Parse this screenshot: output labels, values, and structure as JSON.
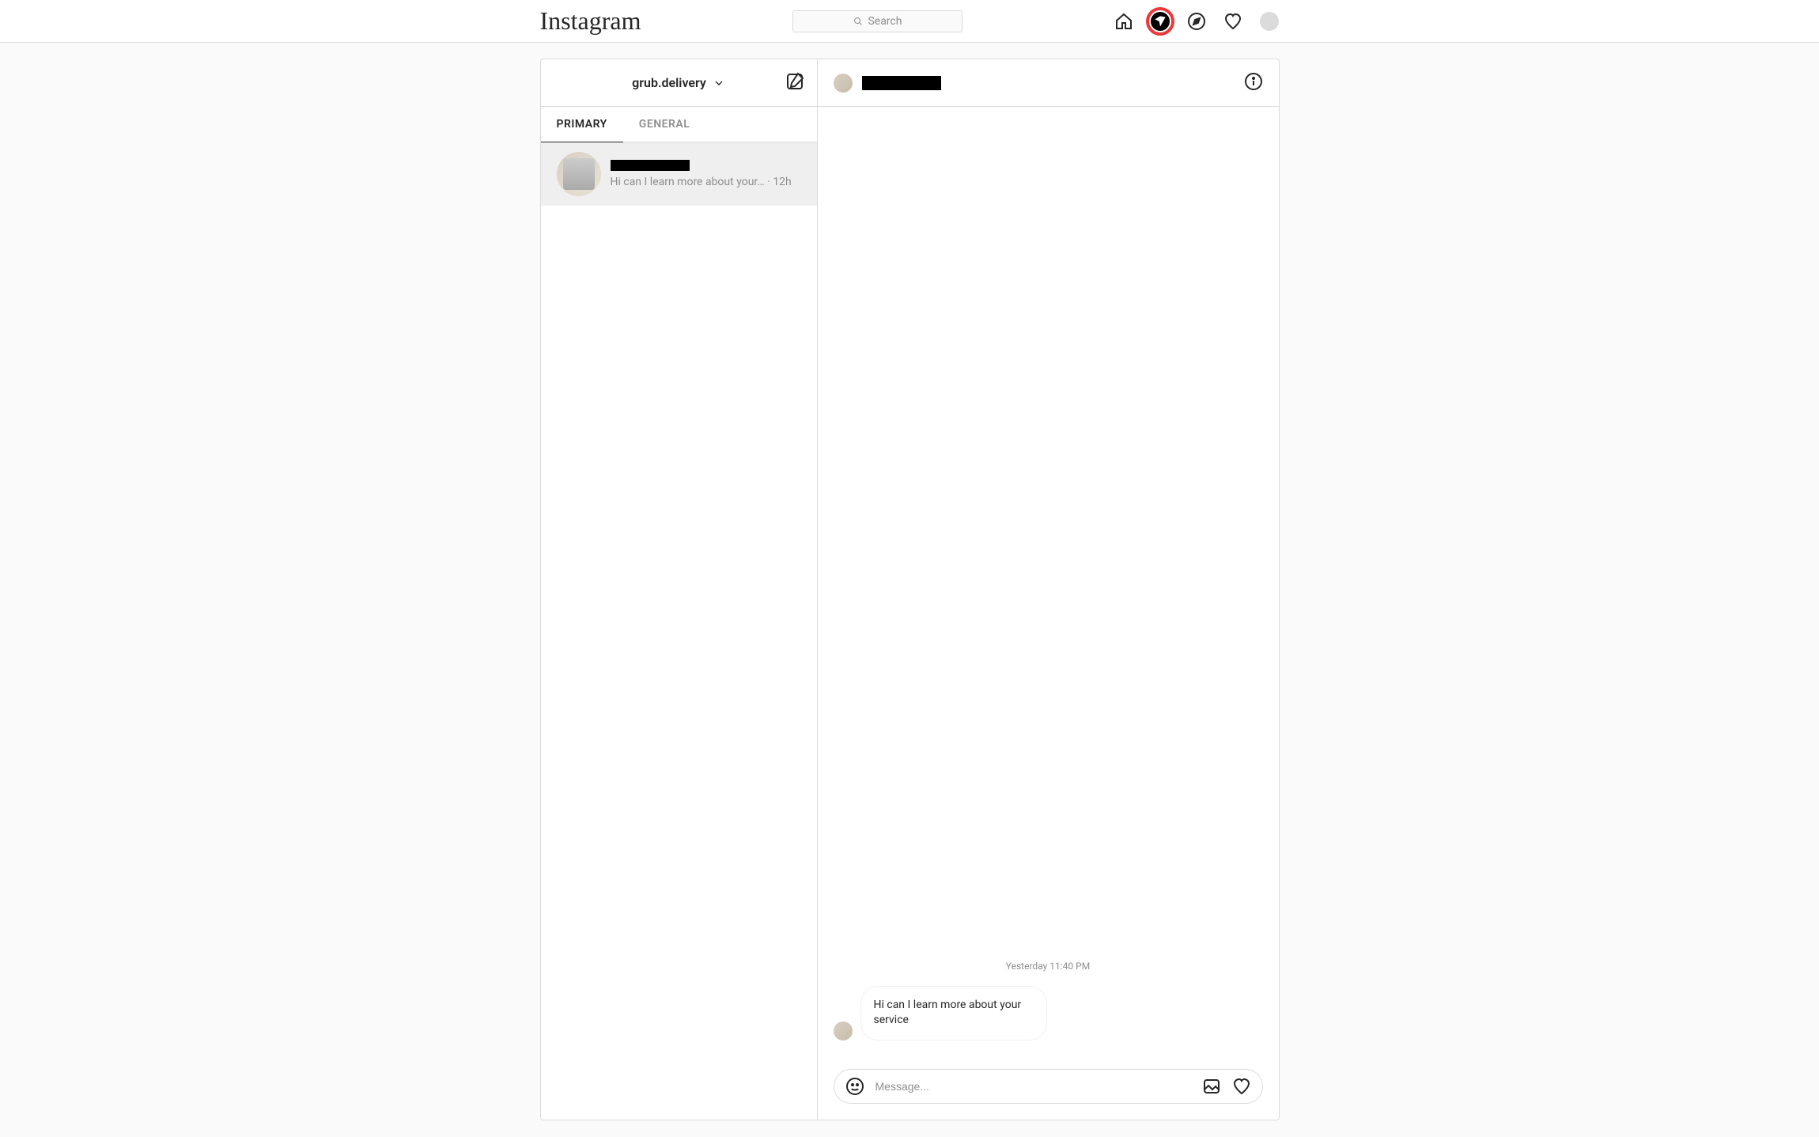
{
  "nav": {
    "logo_text": "Instagram",
    "search_placeholder": "Search"
  },
  "sidebar": {
    "account_name": "grub.delivery",
    "tabs": [
      {
        "label": "PRIMARY",
        "active": true
      },
      {
        "label": "GENERAL",
        "active": false
      }
    ],
    "threads": [
      {
        "preview": "Hi can I learn more about your…",
        "time": "12h",
        "active": true
      }
    ]
  },
  "chat": {
    "timestamp": "Yesterday 11:40 PM",
    "messages": [
      {
        "text": "Hi can I learn more about your service"
      }
    ],
    "composer_placeholder": "Message..."
  }
}
